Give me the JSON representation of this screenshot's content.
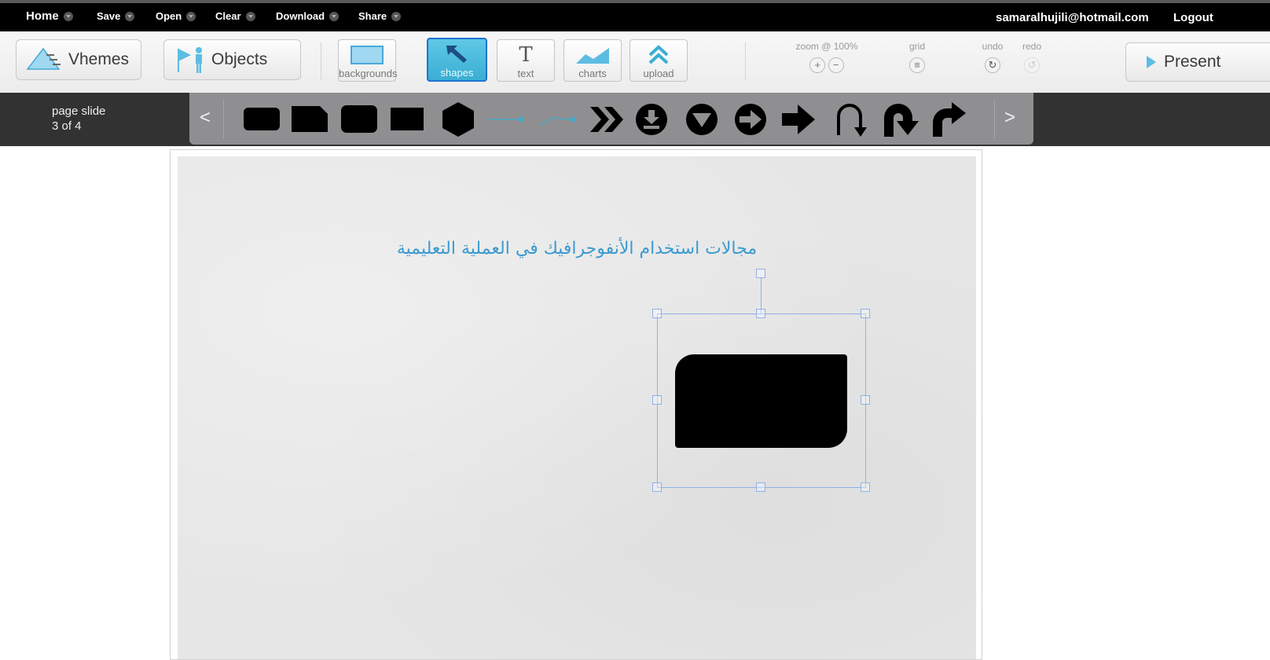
{
  "topbar": {
    "home": "Home",
    "save": "Save",
    "open": "Open",
    "clear": "Clear",
    "download": "Download",
    "share": "Share",
    "email": "samaralhujili@hotmail.com",
    "logout": "Logout"
  },
  "toolbar": {
    "vhemes": "Vhemes",
    "objects": "Objects",
    "tools": [
      {
        "label": "backgrounds",
        "icon": "background-icon"
      },
      {
        "label": "shapes",
        "icon": "arrow-cursor-icon",
        "active": true
      },
      {
        "label": "text",
        "icon": "text-T-icon"
      },
      {
        "label": "charts",
        "icon": "chart-icon"
      },
      {
        "label": "upload",
        "icon": "upload-icon"
      }
    ],
    "zoom_label": "zoom @ 100%",
    "grid_label": "grid",
    "undo_label": "undo",
    "redo_label": "redo",
    "present": "Present"
  },
  "strip": {
    "page_label": "page slide",
    "page_count": "3 of 4",
    "prev": "<",
    "next": ">",
    "shapes": [
      "rounded-rectangle",
      "snipped-rectangle",
      "rounded-square",
      "rectangle",
      "hexagon",
      "connector-straight",
      "connector-curved",
      "double-chevron",
      "download-circle",
      "triangle-circle",
      "arrow-circle",
      "right-arrow",
      "u-turn-arrow",
      "curved-arrow",
      "bent-arrow"
    ]
  },
  "slide": {
    "title": "مجالات استخدام الأنفوجرافيك في العملية التعليمية"
  },
  "colors": {
    "accent": "#3aaed3",
    "title_color": "#3b9ad0",
    "selection": "#8fb0ea"
  }
}
